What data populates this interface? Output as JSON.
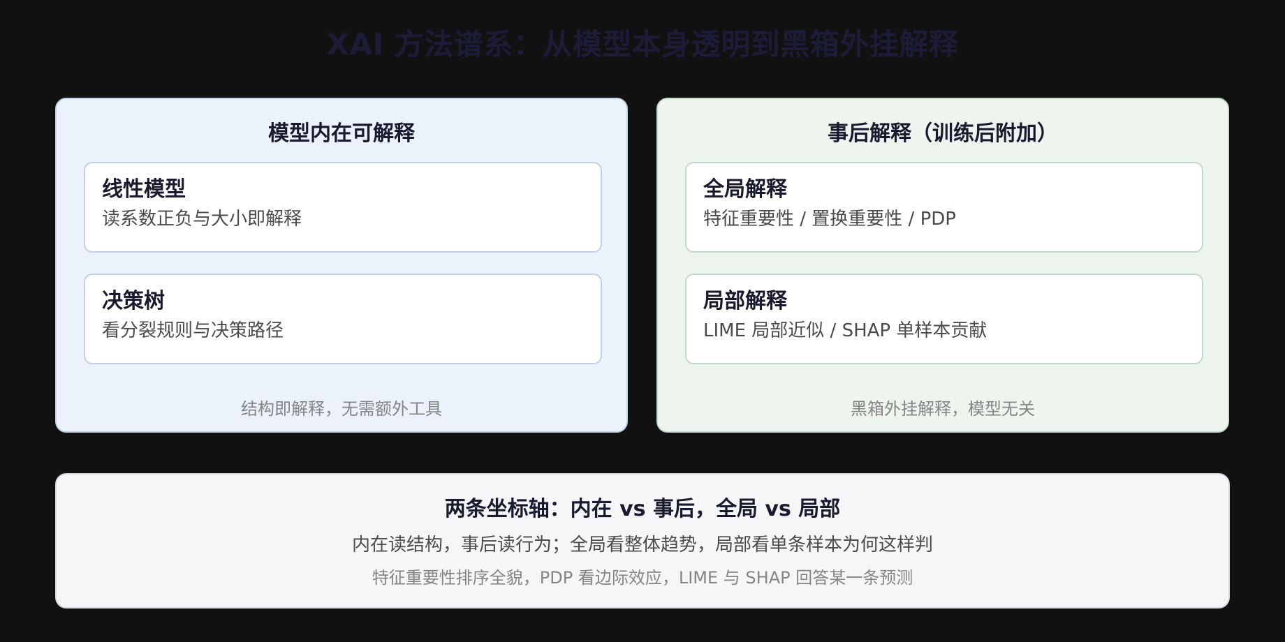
{
  "title": "XAI 方法谱系：从模型本身透明到黑箱外挂解释",
  "colors": {
    "background": "#111111",
    "title": "#1c1c38",
    "intrinsic_panel_bg": "#ecf2fb",
    "posthoc_panel_bg": "#eef5ef",
    "summary_bg": "#f5f6f8"
  },
  "intrinsic": {
    "heading": "模型内在可解释",
    "cards": [
      {
        "title": "线性模型",
        "desc": "读系数正负与大小即解释"
      },
      {
        "title": "决策树",
        "desc": "看分裂规则与决策路径"
      }
    ],
    "note": "结构即解释，无需额外工具"
  },
  "posthoc": {
    "heading": "事后解释（训练后附加）",
    "cards": [
      {
        "title": "全局解释",
        "desc": "特征重要性 / 置换重要性 / PDP"
      },
      {
        "title": "局部解释",
        "desc": "LIME 局部近似 / SHAP 单样本贡献"
      }
    ],
    "note": "黑箱外挂解释，模型无关"
  },
  "summary": {
    "heading": "两条坐标轴：内在 vs 事后，全局 vs 局部",
    "line1": "内在读结构，事后读行为；全局看整体趋势，局部看单条样本为何这样判",
    "line2": "特征重要性排序全貌，PDP 看边际效应，LIME 与 SHAP 回答某一条预测"
  }
}
